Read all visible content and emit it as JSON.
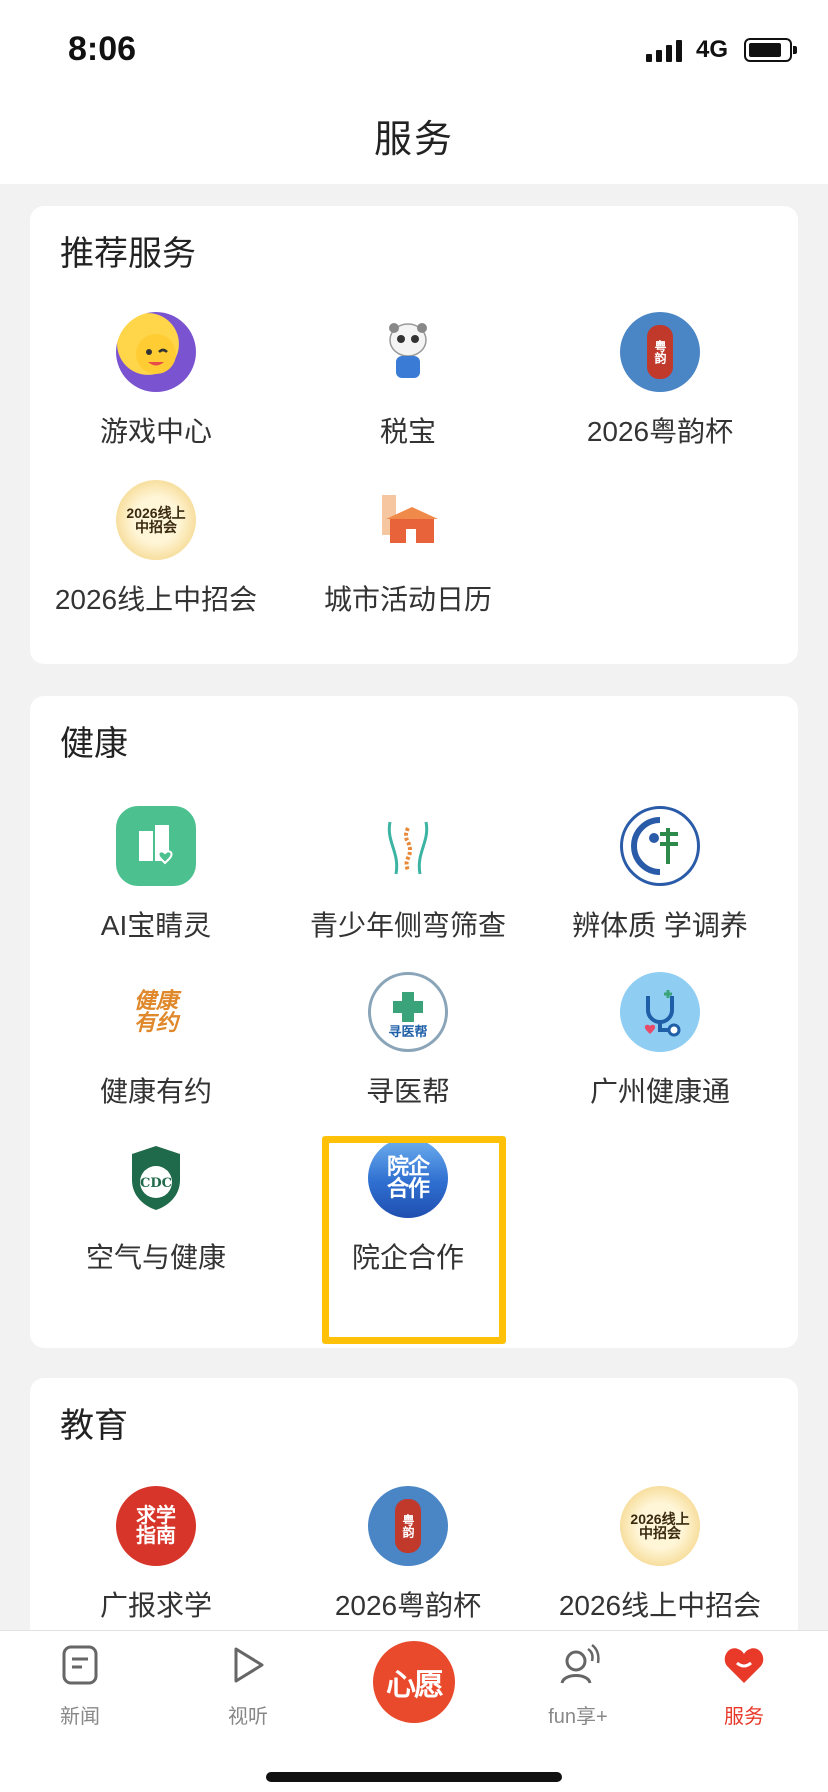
{
  "status": {
    "time": "8:06",
    "network": "4G"
  },
  "header": {
    "title": "服务"
  },
  "sections": [
    {
      "title": "推荐服务",
      "items": [
        {
          "label": "游戏中心",
          "icon": "game-mascot-icon",
          "icon_text": "",
          "color": "#6a4fc3"
        },
        {
          "label": "税宝",
          "icon": "tax-mascot-icon",
          "icon_text": "",
          "color": "#e8eef5"
        },
        {
          "label": "2026粤韵杯",
          "icon": "yueyun-cup-icon",
          "icon_text": "粤韵",
          "color": "#4a86c5"
        },
        {
          "label": "2026线上中招会",
          "icon": "recruitment-fair-icon",
          "icon_text": "2026线上\n中招会",
          "color": "#f2d58a"
        },
        {
          "label": "城市活动日历",
          "icon": "city-calendar-icon",
          "icon_text": "",
          "color": "#f08a4b"
        }
      ]
    },
    {
      "title": "健康",
      "items": [
        {
          "label": "AI宝睛灵",
          "icon": "ai-eye-icon",
          "icon_text": "",
          "color": "#4cc08f"
        },
        {
          "label": "青少年侧弯筛查",
          "icon": "spine-icon",
          "icon_text": "",
          "color": "#3cb4a4"
        },
        {
          "label": "辨体质 学调养",
          "icon": "constitution-icon",
          "icon_text": "",
          "color": "#2a5ba8"
        },
        {
          "label": "健康有约",
          "icon": "health-appointment-icon",
          "icon_text": "健康\n有约",
          "color": "#e0892c"
        },
        {
          "label": "寻医帮",
          "icon": "find-doctor-icon",
          "icon_text": "寻医帮",
          "color": "#3a7ab8"
        },
        {
          "label": "广州健康通",
          "icon": "stethoscope-icon",
          "icon_text": "",
          "color": "#4aa4e0"
        },
        {
          "label": "空气与健康",
          "icon": "cdc-icon",
          "icon_text": "CDC",
          "color": "#1f6a4a"
        },
        {
          "label": "院企合作",
          "icon": "hospital-enterprise-icon",
          "icon_text": "院企\n合作",
          "color": "#2f6fd0"
        }
      ]
    },
    {
      "title": "教育",
      "items": [
        {
          "label": "广报求学",
          "icon": "study-guide-icon",
          "icon_text": "求学\n指南",
          "color": "#d8352a"
        },
        {
          "label": "2026粤韵杯",
          "icon": "yueyun-cup-icon",
          "icon_text": "粤韵",
          "color": "#4a86c5"
        },
        {
          "label": "2026线上中招会",
          "icon": "recruitment-fair-icon",
          "icon_text": "2026线上\n中招会",
          "color": "#f2d58a"
        }
      ]
    }
  ],
  "tabs": [
    {
      "label": "新闻",
      "icon": "news-icon"
    },
    {
      "label": "视听",
      "icon": "play-icon"
    },
    {
      "label": "心愿",
      "icon": "wish-button"
    },
    {
      "label": "fun享+",
      "icon": "fun-user-icon"
    },
    {
      "label": "服务",
      "icon": "heart-service-icon"
    }
  ]
}
